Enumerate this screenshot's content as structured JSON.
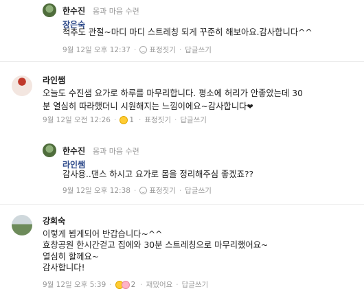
{
  "comments": [
    {
      "author": "한수진",
      "tag": "몸과 마음 수련",
      "mention": "장은숙",
      "lines": [
        "척추도 관절~마디 마디 스트레칭 되게 꾸준히 해보아요.감사합니다^^"
      ],
      "time": "9월 12일 오후 12:37",
      "react_label": "표정짓기",
      "reply_label": "답글쓰기"
    },
    {
      "author": "라인쌤",
      "lines": [
        "오늘도 수진샘 요가로 하루를 마무리합니다. 평소에 허리가 안좋았는데 30",
        "분 열심히 따라했더니 시원해지는 느낌이에요~감사합니다"
      ],
      "heart": "❤",
      "time": "9월 12일 오전 12:26",
      "reaction_count": "1",
      "react_label": "표정짓기",
      "reply_label": "답글쓰기"
    },
    {
      "author": "한수진",
      "tag": "몸과 마음 수련",
      "mention": "라인쌤",
      "lines": [
        "감사용..댄스 하시고 요가로 몸을 정리해주심 좋겠죠??"
      ],
      "time": "9월 12일 오후 12:38",
      "react_label": "표정짓기",
      "reply_label": "답글쓰기"
    },
    {
      "author": "강희숙",
      "lines": [
        "이렇게 뵙게되어 반갑습니다~^^",
        "효창공원 한시간걷고 집에와 30분 스트레칭으로 마무리했어요~",
        "열심히 할께요~",
        "감사합니다!"
      ],
      "time": "9월 12일 오후 5:39",
      "reaction_count": "2",
      "react_label": "재밌어요",
      "reply_label": "답글쓰기"
    }
  ]
}
